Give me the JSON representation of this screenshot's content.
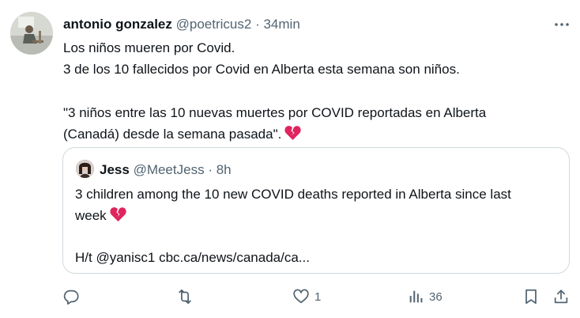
{
  "tweet": {
    "author_name": "antonio gonzalez",
    "author_handle": "@poetricus2",
    "separator": "·",
    "time": "34min",
    "lines": [
      "Los niños mueren por Covid.",
      "3 de los 10 fallecidos por Covid en Alberta esta semana son niños.",
      "\"3 niños entre las 10 nuevas muertes por COVID reportadas en Alberta",
      "(Canadá) desde la semana pasada\"."
    ],
    "emoji": "broken-heart-icon"
  },
  "quote": {
    "author_name": "Jess",
    "author_handle": "@MeetJess",
    "separator": "·",
    "time": "8h",
    "lines": [
      "3 children among the 10 new COVID deaths reported in Alberta since last",
      "week"
    ],
    "link_line": "H/t @yanisc1 cbc.ca/news/canada/ca..."
  },
  "actions": {
    "reply_count": "",
    "retweet_count": "",
    "like_count": "1",
    "views_count": "36"
  },
  "colors": {
    "text": "#0f1419",
    "secondary": "#536471",
    "border": "#cfd9de",
    "heart": "#e0245e"
  }
}
